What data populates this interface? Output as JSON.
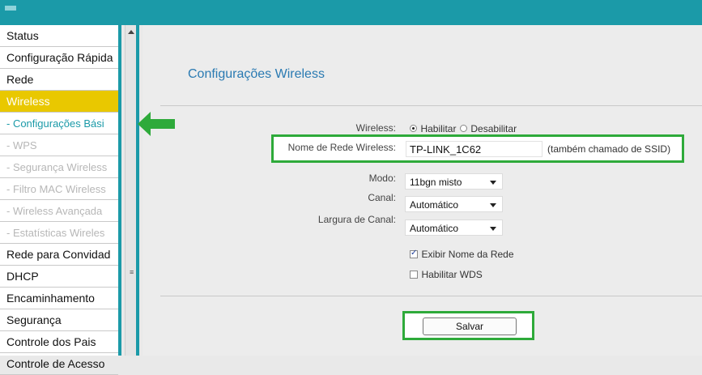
{
  "sidebar": {
    "items": [
      {
        "label": "Status"
      },
      {
        "label": "Configuração Rápida"
      },
      {
        "label": "Rede"
      },
      {
        "label": "Wireless"
      },
      {
        "label": "- Configurações Bási"
      },
      {
        "label": "- WPS"
      },
      {
        "label": "- Segurança Wireless"
      },
      {
        "label": "- Filtro MAC Wireless"
      },
      {
        "label": "- Wireless Avançada"
      },
      {
        "label": "- Estatísticas Wireles"
      },
      {
        "label": "Rede para Convidad"
      },
      {
        "label": "DHCP"
      },
      {
        "label": "Encaminhamento"
      },
      {
        "label": "Segurança"
      },
      {
        "label": "Controle dos Pais"
      },
      {
        "label": "Controle de Acesso"
      }
    ],
    "scroll_grip": "≡"
  },
  "main": {
    "title": "Configurações Wireless",
    "wireless": {
      "label": "Wireless:",
      "enable": "Habilitar",
      "disable": "Desabilitar",
      "selected": "Habilitar"
    },
    "ssid": {
      "label": "Nome de Rede Wireless:",
      "value": "TP-LINK_1C62",
      "hint": "(também chamado de SSID)"
    },
    "mode": {
      "label": "Modo:",
      "value": "11bgn misto"
    },
    "channel": {
      "label": "Canal:",
      "value": "Automático"
    },
    "width": {
      "label": "Largura de Canal:",
      "value": "Automático"
    },
    "show_name": {
      "label": "Exibir Nome da Rede",
      "checked": true
    },
    "wds": {
      "label": "Habilitar WDS",
      "checked": false
    },
    "save_label": "Salvar"
  },
  "colors": {
    "accent": "#1b9aa8",
    "active_menu": "#e9c800",
    "highlight_box": "#2eaa3a",
    "title": "#2a7ab2"
  },
  "icons": {
    "pointer_arrow": "arrow-left-icon",
    "scroll_up": "chevron-up-icon"
  }
}
